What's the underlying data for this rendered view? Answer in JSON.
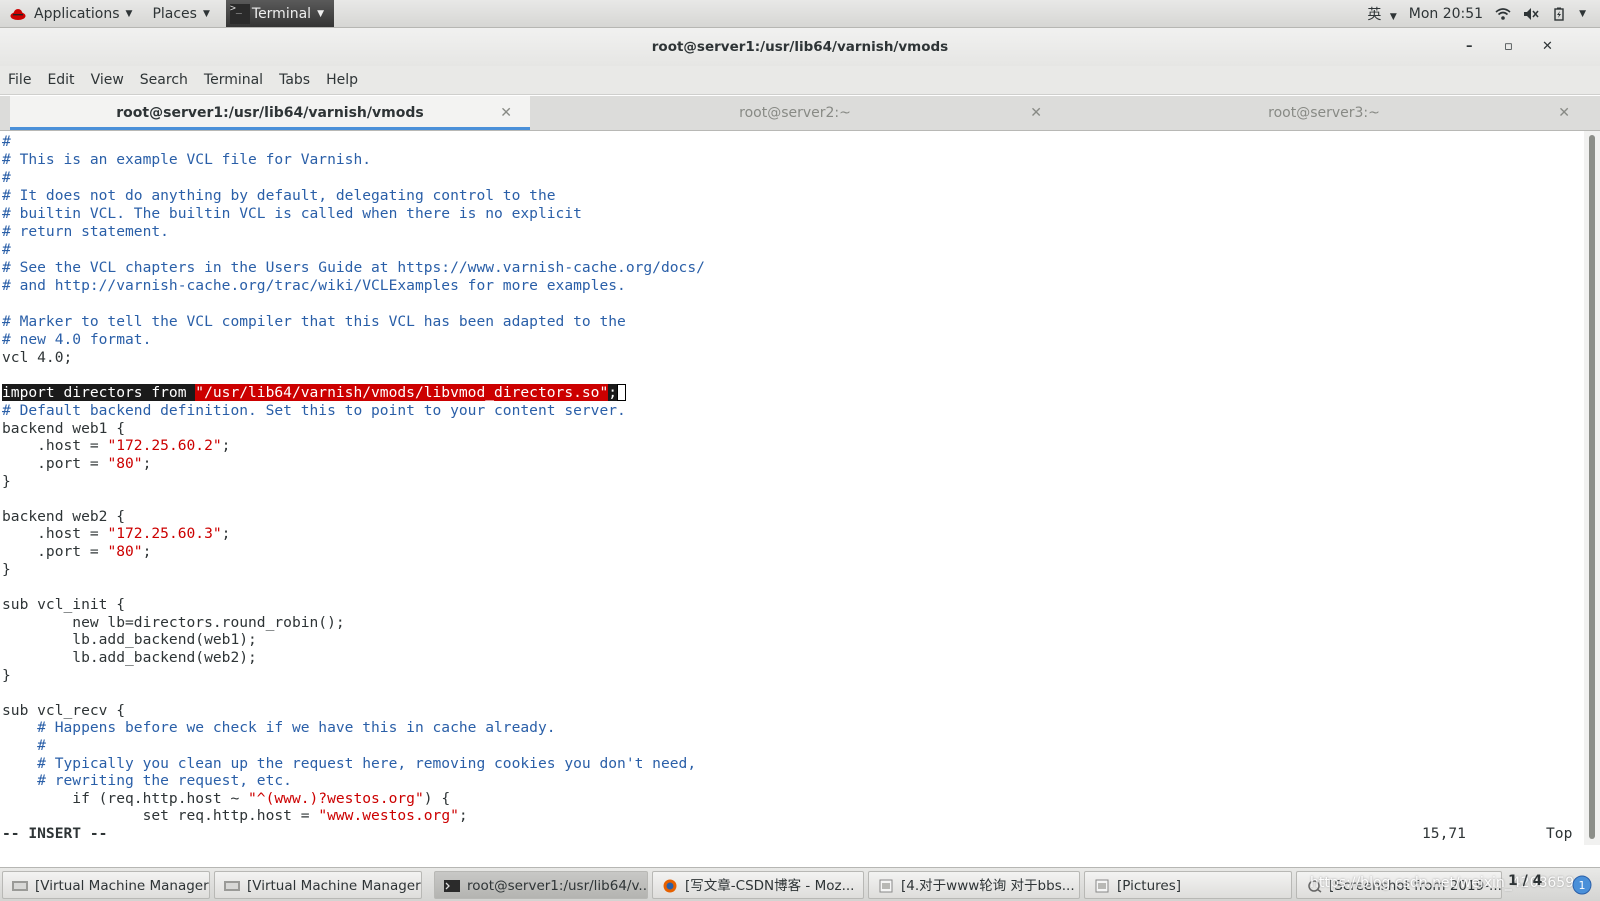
{
  "topbar": {
    "applications": "Applications",
    "places": "Places",
    "terminal": "Terminal",
    "input_method": "英",
    "clock": "Mon 20:51"
  },
  "window": {
    "title": "root@server1:/usr/lib64/varnish/vmods",
    "minimize": "–",
    "maximize": "▫",
    "close": "✕"
  },
  "menu": [
    "File",
    "Edit",
    "View",
    "Search",
    "Terminal",
    "Tabs",
    "Help"
  ],
  "tabs": [
    {
      "label": "root@server1:/usr/lib64/varnish/vmods",
      "active": true
    },
    {
      "label": "root@server2:~",
      "active": false
    },
    {
      "label": "root@server3:~",
      "active": false
    }
  ],
  "editor": {
    "lines": [
      "#",
      "# This is an example VCL file for Varnish.",
      "#",
      "# It does not do anything by default, delegating control to the",
      "# builtin VCL. The builtin VCL is called when there is no explicit",
      "# return statement.",
      "#",
      "# See the VCL chapters in the Users Guide at https://www.varnish-cache.org/docs/",
      "# and http://varnish-cache.org/trac/wiki/VCLExamples for more examples.",
      "",
      "# Marker to tell the VCL compiler that this VCL has been adapted to the",
      "# new 4.0 format.",
      "vcl 4.0;",
      "",
      "",
      "# Default backend definition. Set this to point to your content server.",
      "backend web1 {",
      "",
      "",
      "}",
      "",
      "backend web2 {",
      "",
      "",
      "}",
      "",
      "sub vcl_init {",
      "        new lb=directors.round_robin();",
      "        lb.add_backend(web1);",
      "        lb.add_backend(web2);",
      "}",
      "",
      "sub vcl_recv {",
      "    # Happens before we check if we have this in cache already.",
      "    #",
      "    # Typically you clean up the request here, removing cookies you don't need,",
      "    # rewriting the request, etc.",
      "",
      ""
    ],
    "import_kw": "import directors from ",
    "import_path": "\"/usr/lib64/varnish/vmods/libvmod_directors.so\"",
    "import_semi": ";",
    "host_kw": "    .host = ",
    "port_kw": "    .port = ",
    "semi": ";",
    "web1_host": "\"172.25.60.2\"",
    "web1_port": "\"80\"",
    "web2_host": "\"172.25.60.3\"",
    "web2_port": "\"80\"",
    "if_kw": "        if (req.http.host ~ ",
    "if_regex": "\"^(www.)?westos.org\"",
    "if_end": ") {",
    "set_kw": "                set req.http.host = ",
    "set_val": "\"www.westos.org\"",
    "mode": "-- INSERT --",
    "position": "15,71",
    "scroll": "Top"
  },
  "taskbar": {
    "items": [
      "[Virtual Machine Manager]",
      "[Virtual Machine Manager]",
      "root@server1:/usr/lib64/v...",
      "[写文章-CSDN博客 - Moz...",
      "[4.对于www轮询 对于bbs...",
      "[Pictures]",
      "[Screenshot from 2019-..."
    ],
    "watermark": "https://blog.csdn.net/weixin_4208659",
    "pager": "1 / 4"
  }
}
